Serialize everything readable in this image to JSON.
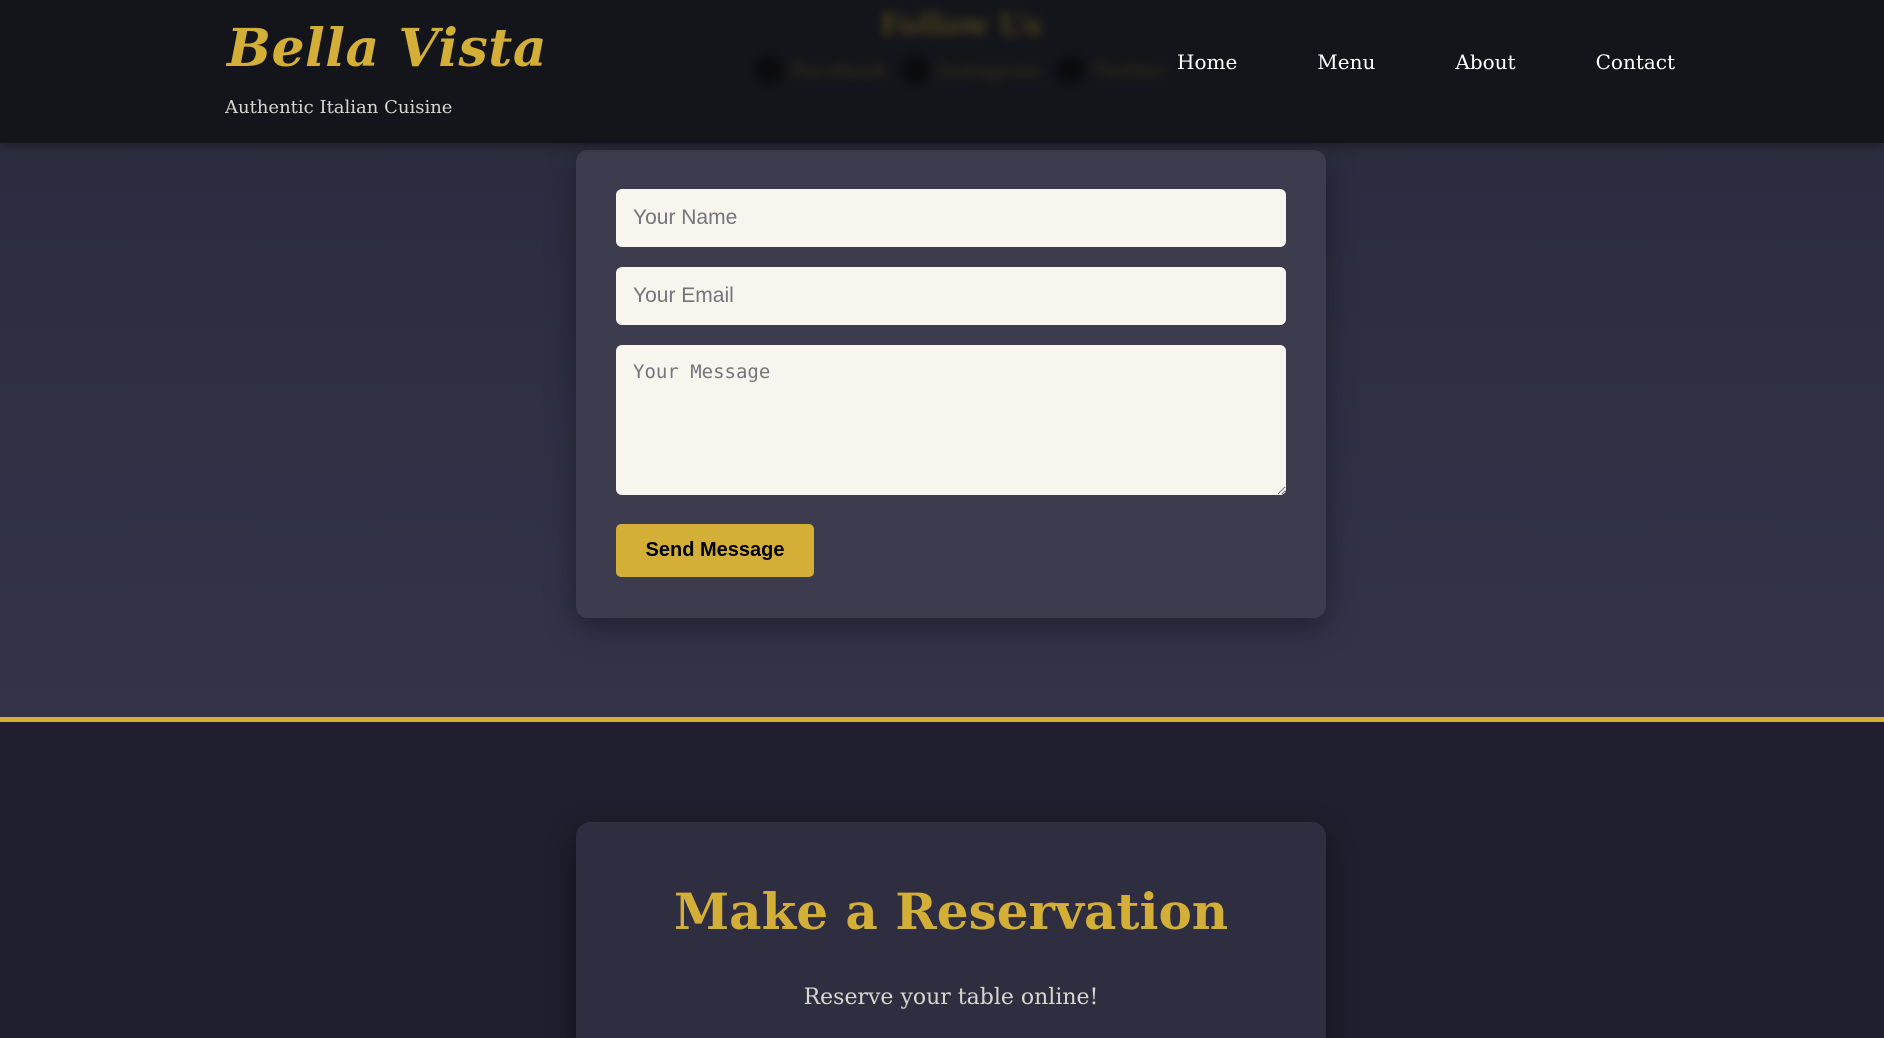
{
  "header": {
    "brand": "Bella Vista",
    "tagline": "Authentic Italian Cuisine",
    "follow": {
      "title": "Follow Us",
      "links": [
        "Facebook",
        "Instagram",
        "Twitter"
      ]
    },
    "nav": [
      "Home",
      "Menu",
      "About",
      "Contact"
    ]
  },
  "contact_form": {
    "name_placeholder": "Your Name",
    "email_placeholder": "Your Email",
    "message_placeholder": "Your Message",
    "submit_label": "Send Message"
  },
  "reservation": {
    "title": "Make a Reservation",
    "subtitle": "Reserve your table online!"
  },
  "colors": {
    "accent": "#d4af37",
    "header_bg": "#14151b",
    "section_bg": "#2c2c3f",
    "card_bg": "#3d3c4e",
    "input_bg": "#f8f5ef"
  }
}
